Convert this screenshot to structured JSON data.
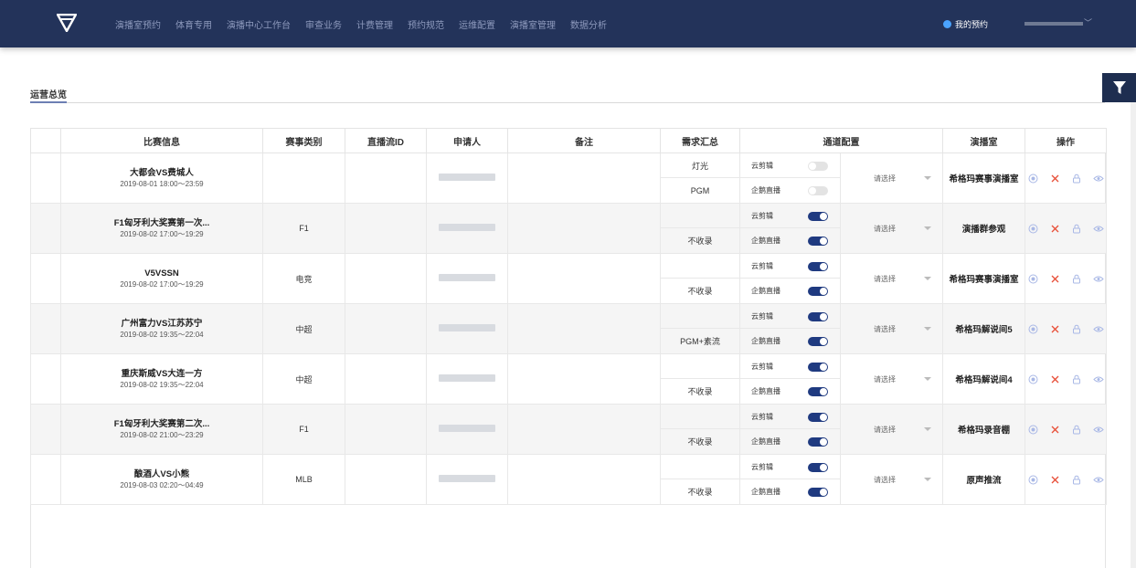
{
  "nav": {
    "items": [
      "演播室预约",
      "体育专用",
      "演播中心工作台",
      "审查业务",
      "计费管理",
      "预约规范",
      "运维配置",
      "演播室管理",
      "数据分析"
    ],
    "my_reservation": "我的预约"
  },
  "tab": {
    "label": "运营总览"
  },
  "table": {
    "headers": [
      "比赛信息",
      "赛事类别",
      "直播流ID",
      "申请人",
      "备注",
      "需求汇总",
      "通道配置",
      "演播室",
      "操作"
    ],
    "channel_labels": [
      "云剪辑",
      "企鹅直播"
    ],
    "select_placeholder": "请选择",
    "rows": [
      {
        "name": "大都会VS费城人",
        "time": "2019-08-01 18:00～23:59",
        "category": "",
        "req_top": "灯光",
        "req_bot": "PGM",
        "toggles": [
          false,
          false
        ],
        "studio": "希格玛赛事演播室"
      },
      {
        "name": "F1匈牙利大奖赛第一次...",
        "time": "2019-08-02 17:00～19:29",
        "category": "F1",
        "req_top": "",
        "req_bot": "不收录",
        "toggles": [
          true,
          true
        ],
        "studio": "演播群参观"
      },
      {
        "name": "V5VSSN",
        "time": "2019-08-02 17:00～19:29",
        "category": "电竞",
        "req_top": "",
        "req_bot": "不收录",
        "toggles": [
          true,
          true
        ],
        "studio": "希格玛赛事演播室"
      },
      {
        "name": "广州富力VS江苏苏宁",
        "time": "2019-08-02 19:35～22:04",
        "category": "中超",
        "req_top": "",
        "req_bot": "PGM+素流",
        "toggles": [
          true,
          true
        ],
        "studio": "希格玛解说间5"
      },
      {
        "name": "重庆斯威VS大连一方",
        "time": "2019-08-02 19:35～22:04",
        "category": "中超",
        "req_top": "",
        "req_bot": "不收录",
        "toggles": [
          true,
          true
        ],
        "studio": "希格玛解说间4"
      },
      {
        "name": "F1匈牙利大奖赛第二次...",
        "time": "2019-08-02 21:00～23:29",
        "category": "F1",
        "req_top": "",
        "req_bot": "不收录",
        "toggles": [
          true,
          true
        ],
        "studio": "希格玛录音棚"
      },
      {
        "name": "酿酒人VS小熊",
        "time": "2019-08-03 02:20～04:49",
        "category": "MLB",
        "req_top": "",
        "req_bot": "不收录",
        "toggles": [
          true,
          true
        ],
        "studio": "原声推流"
      }
    ]
  },
  "icons": {
    "logo": "logo-icon",
    "filter": "filter-icon",
    "ops": [
      "record-icon",
      "delete-icon",
      "lock-icon",
      "view-icon"
    ]
  },
  "colors": {
    "nav_bg": "#23335a",
    "toggle_on": "#1f3a80",
    "delete_red": "#e8503a",
    "op_blue": "#a9b8e6"
  }
}
